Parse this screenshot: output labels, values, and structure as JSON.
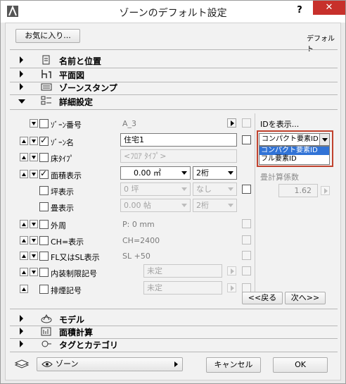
{
  "window": {
    "title": "ゾーンのデフォルト設定",
    "help": "?",
    "close": "✕"
  },
  "toolbar": {
    "favorites_label": "お気に入り...",
    "default_label": "デフォルト"
  },
  "sections_top": [
    {
      "label": "名前と位置",
      "icon": "name-position-icon"
    },
    {
      "label": "平面図",
      "icon": "floor-plan-icon"
    },
    {
      "label": "ゾーンスタンプ",
      "icon": "zone-stamp-icon"
    },
    {
      "label": "詳細設定",
      "icon": "detail-settings-icon"
    }
  ],
  "rows": [
    {
      "label": "ｿﾞｰﾝ番号",
      "value": "A_3",
      "checked": false
    },
    {
      "label": "ｿﾞｰﾝ名",
      "value": "住宅1",
      "checked": true
    },
    {
      "label": "床ﾀｲﾌﾟ",
      "value": "<ﾌﾛｱ ﾀｲﾌﾟ>",
      "checked": false
    },
    {
      "label": "面積表示",
      "value": "0.00 ㎡",
      "unit": "2桁",
      "checked": true
    },
    {
      "label": "坪表示",
      "value": "0 坪",
      "unit": "なし",
      "checked": false
    },
    {
      "label": "畳表示",
      "value": "0.00 帖",
      "unit": "2桁",
      "checked": false
    },
    {
      "label": "外周",
      "value": "P: 0 mm",
      "checked": false
    },
    {
      "label": "CH=表示",
      "value": "CH=2400",
      "checked": false
    },
    {
      "label": "FL又はSL表示",
      "value": "SL +50",
      "checked": false
    },
    {
      "label": "内装制限記号",
      "value": "未定",
      "checked": false
    },
    {
      "label": "排煙記号",
      "value": "未定",
      "checked": false
    }
  ],
  "id_panel": {
    "label": "IDを表示...",
    "selected": "コンパクト要素ID",
    "options": [
      "コンパクト要素ID",
      "フル要素ID"
    ],
    "factor_label": "畳計算係数",
    "factor_value": "1.62"
  },
  "nav": {
    "back": "<<戻る",
    "next": "次へ>>"
  },
  "sections_bottom": [
    {
      "label": "モデル",
      "icon": "model-icon"
    },
    {
      "label": "面積計算",
      "icon": "area-calc-icon"
    },
    {
      "label": "タグとカテゴリ",
      "icon": "tag-category-icon"
    }
  ],
  "footer": {
    "layer_label": "ゾーン",
    "cancel": "キャンセル",
    "ok": "OK"
  },
  "colors": {
    "close_bg": "#c7302b",
    "highlight": "#3173d6",
    "focus_border": "#c0422e"
  }
}
